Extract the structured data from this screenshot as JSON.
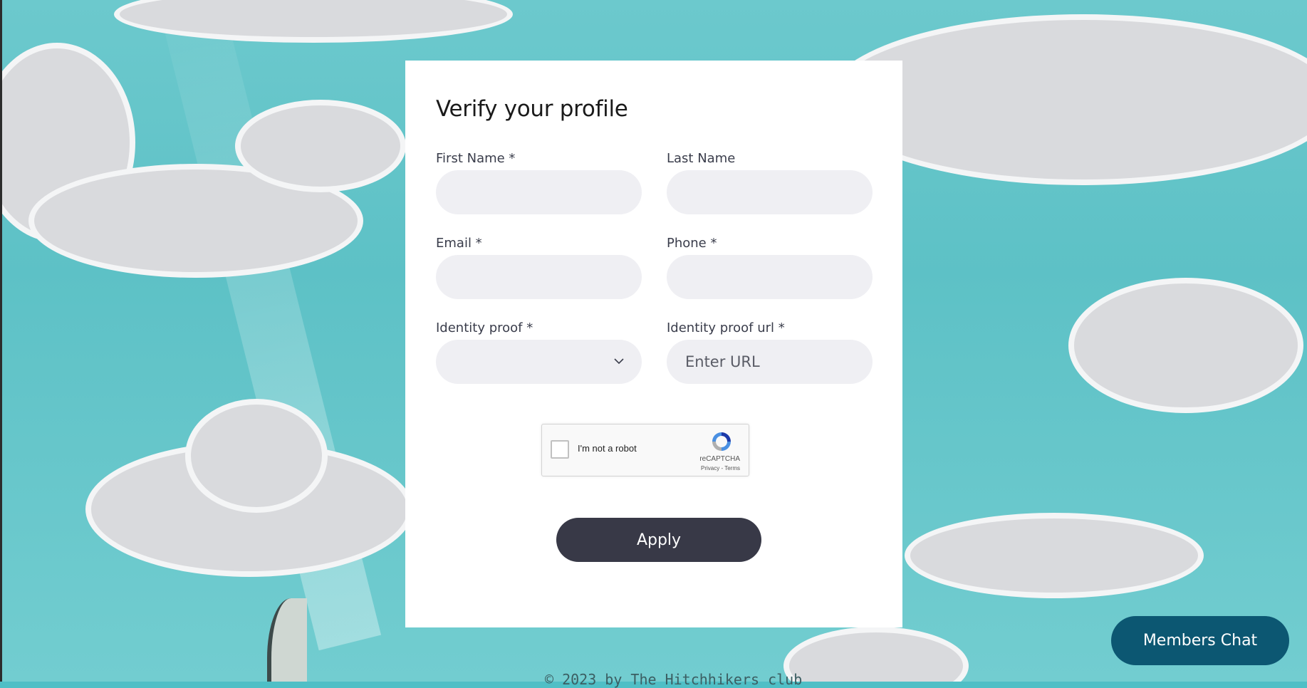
{
  "form": {
    "title": "Verify your profile",
    "first_name": {
      "label": "First Name *",
      "value": ""
    },
    "last_name": {
      "label": "Last Name",
      "value": ""
    },
    "email": {
      "label": "Email *",
      "value": ""
    },
    "phone": {
      "label": "Phone *",
      "value": ""
    },
    "identity_proof": {
      "label": "Identity proof *",
      "selected": "",
      "icon": "chevron-down-icon"
    },
    "identity_proof_url": {
      "label": "Identity proof url *",
      "placeholder": "Enter URL",
      "value": ""
    },
    "apply_label": "Apply"
  },
  "captcha": {
    "checkbox_label": "I'm not a robot",
    "brand": "reCAPTCHA",
    "links": "Privacy - Terms",
    "checked": false
  },
  "footer": {
    "text": "© 2023 by The Hitchhikers club"
  },
  "chat": {
    "label": "Members Chat"
  },
  "colors": {
    "background_sky": "#5dc1c6",
    "card": "#ffffff",
    "input_bg": "#efeff3",
    "apply_bg": "#383947",
    "chat_bg": "#0c5772"
  }
}
